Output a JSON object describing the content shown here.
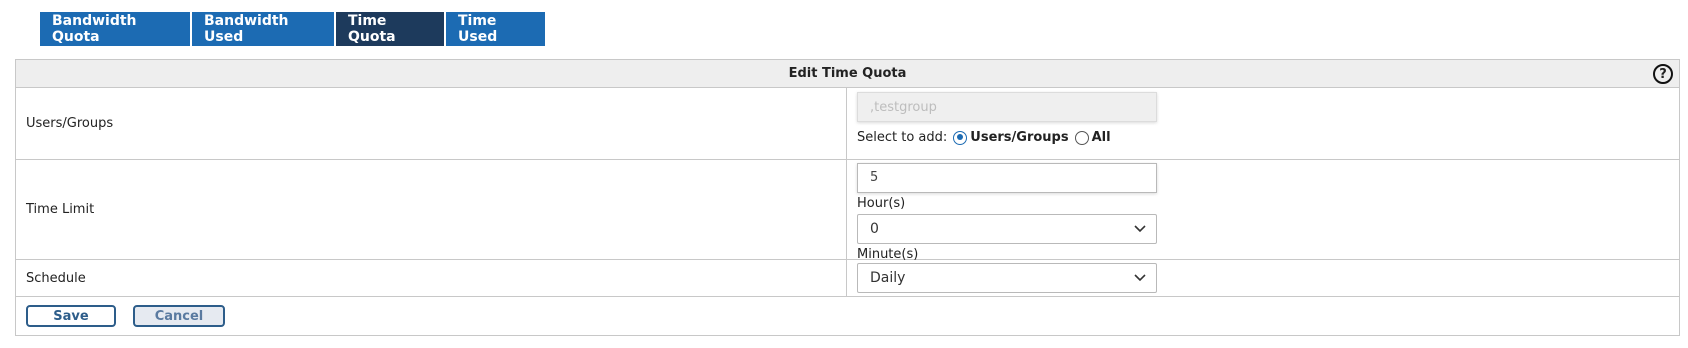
{
  "tabs": [
    {
      "label": "Bandwidth Quota",
      "active": false
    },
    {
      "label": "Bandwidth Used",
      "active": false
    },
    {
      "label": "Time Quota",
      "active": true
    },
    {
      "label": "Time Used",
      "active": false
    }
  ],
  "panel": {
    "title": "Edit Time Quota",
    "help_icon": "?"
  },
  "users_groups": {
    "label": "Users/Groups",
    "value": ",testgroup",
    "select_prefix": "Select to add:",
    "options": [
      {
        "label": "Users/Groups",
        "checked": true
      },
      {
        "label": "All",
        "checked": false
      }
    ]
  },
  "time_limit": {
    "label": "Time Limit",
    "hours_value": "5",
    "hours_label": "Hour(s)",
    "minutes_value": "0",
    "minutes_label": "Minute(s)"
  },
  "schedule": {
    "label": "Schedule",
    "value": "Daily"
  },
  "actions": {
    "save_label": "Save",
    "cancel_label": "Cancel"
  },
  "colors": {
    "tab": "#1c6bb3",
    "tab_active": "#1d3a5c",
    "button_border": "#2d5d8a"
  }
}
